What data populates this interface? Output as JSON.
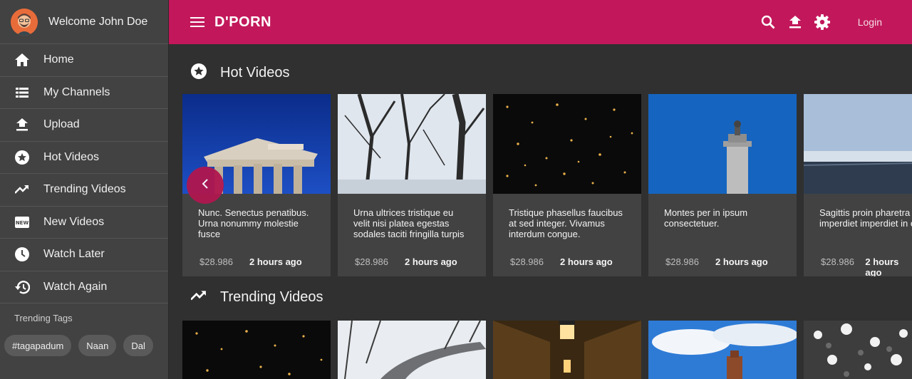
{
  "sidebar": {
    "welcome": "Welcome John Doe",
    "items": [
      {
        "label": "Home",
        "icon": "home-icon"
      },
      {
        "label": "My Channels",
        "icon": "list-icon"
      },
      {
        "label": "Upload",
        "icon": "upload-icon"
      },
      {
        "label": "Hot Videos",
        "icon": "star-circle-icon"
      },
      {
        "label": "Trending Videos",
        "icon": "trending-icon"
      },
      {
        "label": "New Videos",
        "icon": "new-badge-icon"
      },
      {
        "label": "Watch Later",
        "icon": "clock-icon"
      },
      {
        "label": "Watch Again",
        "icon": "history-icon"
      }
    ],
    "tags_title": "Trending Tags",
    "tags": [
      "#tagapadum",
      "Naan",
      "Dal"
    ]
  },
  "header": {
    "brand": "D'PORN",
    "login": "Login"
  },
  "colors": {
    "accent": "#c2185b",
    "sidebar": "#424242",
    "background": "#303030"
  },
  "hot": {
    "title": "Hot Videos",
    "cards": [
      {
        "title": "Nunc. Senectus penatibus. Urna nonummy molestie fusce",
        "price": "$28.986",
        "time": "2 hours ago"
      },
      {
        "title": "Urna ultrices tristique eu velit nisi platea egestas sodales taciti fringilla turpis",
        "price": "$28.986",
        "time": "2 hours ago"
      },
      {
        "title": "Tristique phasellus faucibus at sed integer. Vivamus interdum congue.",
        "price": "$28.986",
        "time": "2 hours ago"
      },
      {
        "title": "Montes per in ipsum consectetuer.",
        "price": "$28.986",
        "time": "2 hours ago"
      },
      {
        "title": "Sagittis proin pharetra habitant imperdiet imperdiet in euismod.",
        "price": "$28.986",
        "time": "2 hours ago"
      }
    ]
  },
  "trending": {
    "title": "Trending Videos"
  }
}
